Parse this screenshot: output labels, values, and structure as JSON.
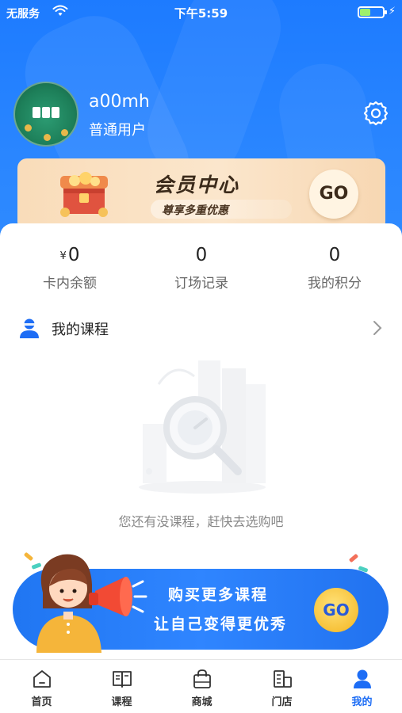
{
  "status_bar": {
    "carrier": "无服务",
    "time": "下午5:59",
    "battery_level": 0.45
  },
  "profile": {
    "username": "a00mh",
    "user_type": "普通用户"
  },
  "member_center": {
    "title": "会员中心",
    "subtitle": "尊享多重优惠",
    "go_label": "GO"
  },
  "stats": [
    {
      "currency": "¥",
      "value": "0",
      "label": "卡内余额"
    },
    {
      "currency": "",
      "value": "0",
      "label": "订场记录"
    },
    {
      "currency": "",
      "value": "0",
      "label": "我的积分"
    }
  ],
  "my_courses": {
    "title": "我的课程",
    "empty_text": "您还有没课程，赶快去选购吧"
  },
  "promo": {
    "title": "购买更多课程",
    "subtitle": "让自己变得更优秀",
    "go_label": "GO"
  },
  "tabbar": {
    "items": [
      {
        "label": "首页",
        "icon": "home-icon",
        "active": false
      },
      {
        "label": "课程",
        "icon": "book-icon",
        "active": false
      },
      {
        "label": "商城",
        "icon": "shopping-bag-icon",
        "active": false
      },
      {
        "label": "门店",
        "icon": "store-icon",
        "active": false
      },
      {
        "label": "我的",
        "icon": "user-icon",
        "active": true
      }
    ]
  },
  "colors": {
    "primary_blue": "#1d7bff",
    "active_tab": "#1d6df5",
    "member_gold": "#f9dcb9"
  }
}
